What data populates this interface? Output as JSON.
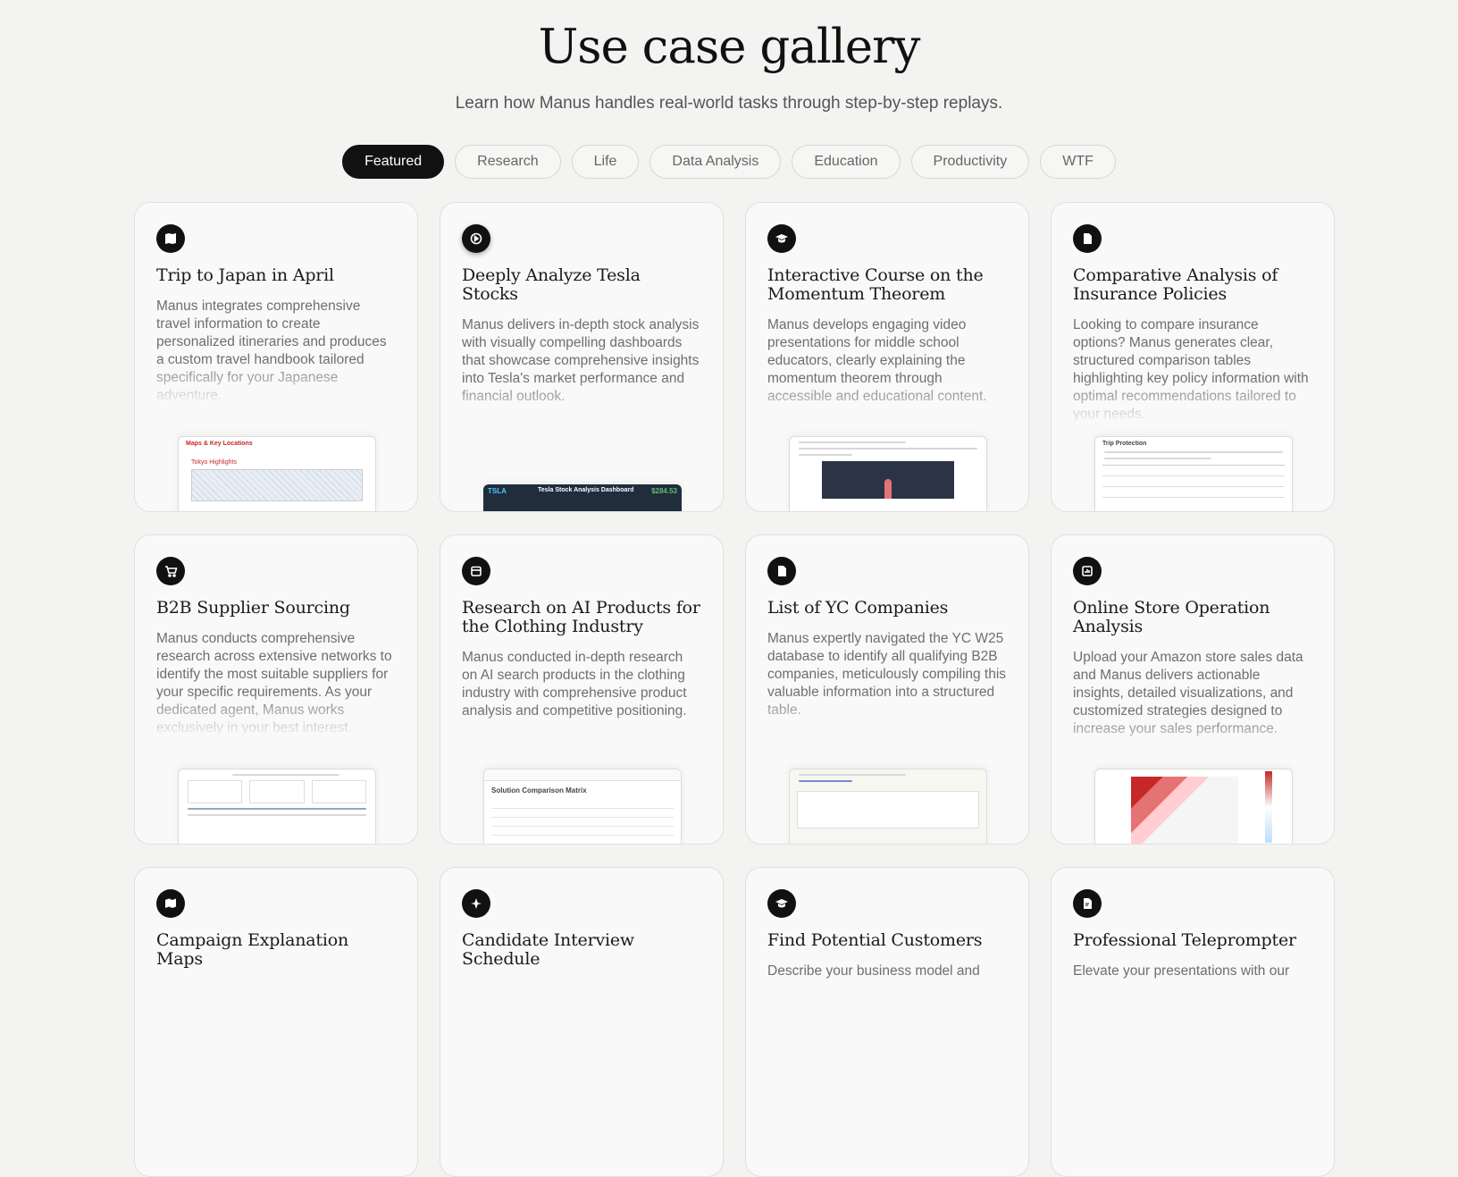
{
  "header": {
    "title": "Use case gallery",
    "subtitle": "Learn how Manus handles real-world tasks through step-by-step replays."
  },
  "tabs": [
    {
      "label": "Featured",
      "active": true
    },
    {
      "label": "Research",
      "active": false
    },
    {
      "label": "Life",
      "active": false
    },
    {
      "label": "Data Analysis",
      "active": false
    },
    {
      "label": "Education",
      "active": false
    },
    {
      "label": "Productivity",
      "active": false
    },
    {
      "label": "WTF",
      "active": false
    }
  ],
  "cards": [
    {
      "icon": "map-book-icon",
      "title": "Trip to Japan in April",
      "desc": "Manus integrates comprehensive travel information to create personalized itineraries and produces a custom travel handbook tailored specifically for your Japanese adventure.",
      "thumb_heading": "Maps & Key Locations",
      "thumb_sub": "Tokyo Highlights"
    },
    {
      "icon": "chart-cycle-icon",
      "title": "Deeply Analyze Tesla Stocks",
      "desc": "Manus delivers in-depth stock analysis with visually compelling dashboards that showcase comprehensive insights into Tesla's market performance and financial outlook.",
      "thumb_heading": "Tesla Stock Analysis Dashboard",
      "thumb_ticker": "TSLA",
      "thumb_price": "$284.53"
    },
    {
      "icon": "graduation-icon",
      "title": "Interactive Course on the Momentum Theorem",
      "desc": "Manus develops engaging video presentations for middle school educators, clearly explaining the momentum theorem through accessible and educational content."
    },
    {
      "icon": "document-icon",
      "title": "Comparative Analysis of Insurance Policies",
      "desc": "Looking to compare insurance options? Manus generates clear, structured comparison tables highlighting key policy information with optimal recommendations tailored to your needs.",
      "thumb_heading": "Trip Protection"
    },
    {
      "icon": "cart-icon",
      "title": "B2B Supplier Sourcing",
      "desc": "Manus conducts comprehensive research across extensive networks to identify the most suitable suppliers for your specific requirements. As your dedicated agent, Manus works exclusively in your best interest."
    },
    {
      "icon": "calendar-icon",
      "title": "Research on AI Products for the Clothing Industry",
      "desc": "Manus conducted in-depth research on AI search products in the clothing industry with comprehensive product analysis and competitive positioning.",
      "thumb_heading": "Solution Comparison Matrix"
    },
    {
      "icon": "document-icon",
      "title": "List of YC Companies",
      "desc": "Manus expertly navigated the YC W25 database to identify all qualifying B2B companies, meticulously compiling this valuable information into a structured table."
    },
    {
      "icon": "bar-chart-icon",
      "title": "Online Store Operation Analysis",
      "desc": "Upload your Amazon store sales data and Manus delivers actionable insights, detailed visualizations, and customized strategies designed to increase your sales performance."
    },
    {
      "icon": "map-icon",
      "title": "Campaign Explanation Maps",
      "desc": ""
    },
    {
      "icon": "compass-icon",
      "title": "Candidate Interview Schedule",
      "desc": ""
    },
    {
      "icon": "graduation-icon",
      "title": "Find Potential Customers",
      "desc": "Describe your business model and"
    },
    {
      "icon": "teleprompter-icon",
      "title": "Professional Teleprompter",
      "desc": "Elevate your presentations with our"
    }
  ]
}
